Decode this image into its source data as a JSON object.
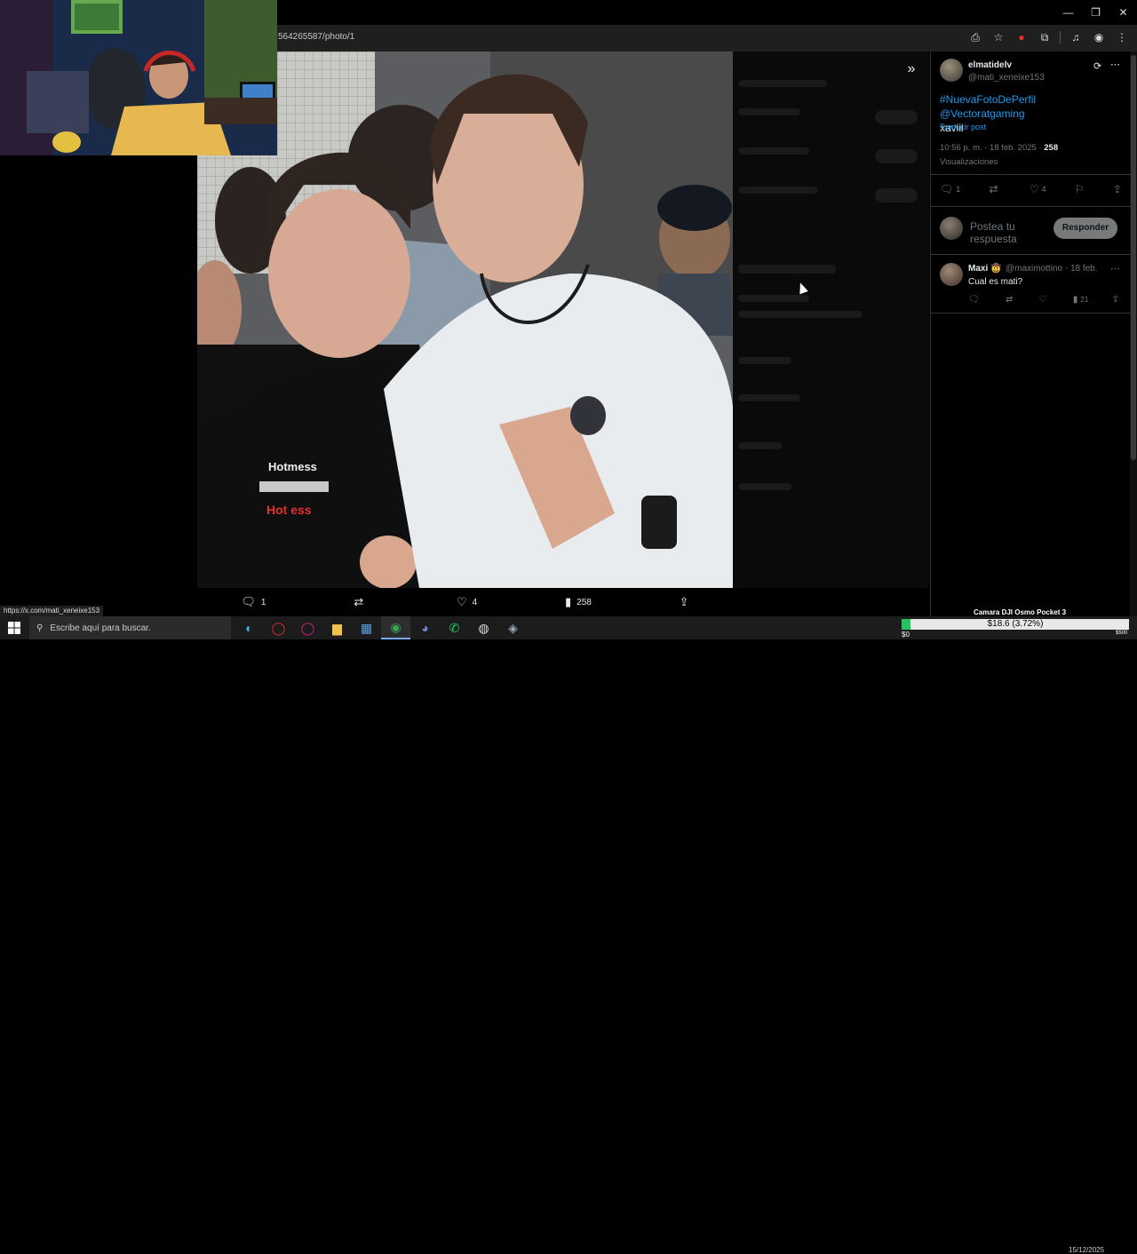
{
  "window": {
    "minimize": "—",
    "restore": "❐",
    "close": "✕"
  },
  "browser": {
    "url": "564265587/photo/1",
    "status_url": "https://x.com/mati_xeneixe153"
  },
  "photo_actions": {
    "replies": "1",
    "reposts": "",
    "likes": "4",
    "views": "258"
  },
  "post": {
    "author_name": "elmatidelv",
    "author_handle": "@mati_xeneixe153",
    "text_tags": "#NuevaFotoDePerfil @Vectoratgaming",
    "text_rest": "xaviii",
    "translate": "Traducir post",
    "time": "10:56 p. m. · 18 feb. 2025 · ",
    "views_count": "258",
    "views_label": "Visualizaciones",
    "replies": "1",
    "reposts": "",
    "likes": "4"
  },
  "reply_box": {
    "placeholder": "Postea tu respuesta",
    "button": "Responder"
  },
  "reply": {
    "name": "Maxi",
    "badge": "🤠",
    "handle_date": "@maximottino · 18 feb.",
    "text": "Cual es mati?",
    "replies": "",
    "reposts": "",
    "likes": "",
    "views": "21"
  },
  "taskbar": {
    "search_placeholder": "Escribe aquí para buscar.",
    "date": "15/12/2025"
  },
  "overlay": {
    "camera_label": "Camara DJI Osmo Pocket 3",
    "donation_text": "$18.6 (3.72%)",
    "donation_percent": 3.72,
    "donation_min": "$0",
    "donation_max": "$500"
  },
  "colors": {
    "accent": "#1d9bf0",
    "progress": "#22c55e"
  }
}
